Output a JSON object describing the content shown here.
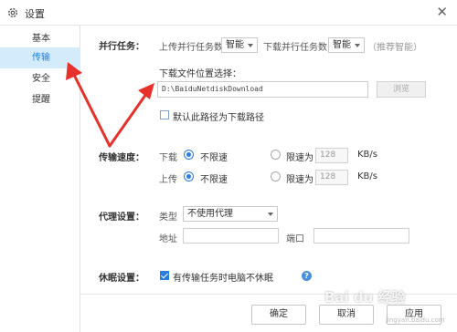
{
  "window": {
    "title": "设置",
    "close_label": "✕"
  },
  "sidebar": {
    "items": [
      {
        "label": "基本",
        "active": false
      },
      {
        "label": "传输",
        "active": true
      },
      {
        "label": "安全",
        "active": false
      },
      {
        "label": "提醒",
        "active": false
      }
    ]
  },
  "parallel": {
    "section_label": "并行任务：",
    "upload_label": "上传并行任务数",
    "upload_value": "智能",
    "download_label": "下载并行任务数",
    "download_value": "智能",
    "recommend_note": "（推荐智能）"
  },
  "download_location": {
    "label": "下载文件位置选择：",
    "path": "D:\\BaiduNetdiskDownload",
    "browse_label": "浏览",
    "default_checkbox_label": "默认此路径为下载路径",
    "default_checked": false
  },
  "speed": {
    "section_label": "传输速度：",
    "download_label": "下载",
    "upload_label": "上传",
    "unlimited_label": "不限速",
    "limit_label": "限速为",
    "download_limit_value": "128",
    "upload_limit_value": "128",
    "unit": "KB/s"
  },
  "proxy": {
    "section_label": "代理设置：",
    "type_label": "类型",
    "type_value": "不使用代理",
    "address_label": "地址",
    "port_label": "端口"
  },
  "sleep": {
    "section_label": "休眠设置：",
    "checkbox_label": "有传输任务时电脑不休眠",
    "checked": true,
    "help_label": "?"
  },
  "footer": {
    "ok_label": "确定",
    "cancel_label": "取消",
    "apply_label": "应用"
  },
  "watermark": {
    "text": "Bai du 经验",
    "sub": "jingyan.baidu.com"
  },
  "colors": {
    "accent": "#2a7ede",
    "active_bg": "#d4ebfc",
    "annotation_arrow": "#e8302a"
  }
}
